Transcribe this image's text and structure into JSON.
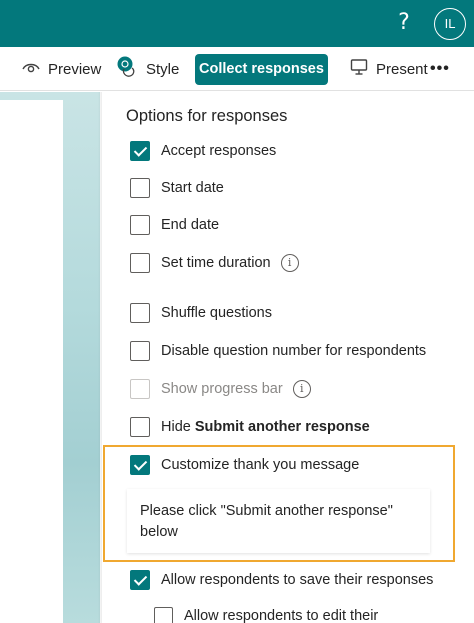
{
  "header": {
    "help_icon": "?",
    "avatar_initials": "IL"
  },
  "toolbar": {
    "preview_label": "Preview",
    "style_label": "Style",
    "collect_label": "Collect responses",
    "present_label": "Present",
    "more_label": "•••"
  },
  "panel": {
    "title": "Options for responses",
    "options": [
      {
        "label": "Accept responses",
        "checked": true
      },
      {
        "label": "Start date",
        "checked": false
      },
      {
        "label": "End date",
        "checked": false
      },
      {
        "label": "Set time duration",
        "checked": false,
        "info": true
      },
      {
        "label": "Shuffle questions",
        "checked": false
      },
      {
        "label": "Disable question number for respondents",
        "checked": false
      },
      {
        "label": "Show progress bar",
        "checked": false,
        "disabled": true,
        "info": true
      },
      {
        "label_prefix": "Hide ",
        "label_bold": "Submit another response",
        "checked": false
      },
      {
        "label": "Customize thank you message",
        "checked": true
      },
      {
        "label": "Allow respondents to save their responses",
        "checked": true
      },
      {
        "label": "Allow respondents to edit their",
        "checked": false
      }
    ],
    "thank_you_message": "Please click \"Submit another response\" below",
    "info_glyph": "i"
  },
  "colors": {
    "brand": "#03787c",
    "highlight": "#f0a830"
  }
}
